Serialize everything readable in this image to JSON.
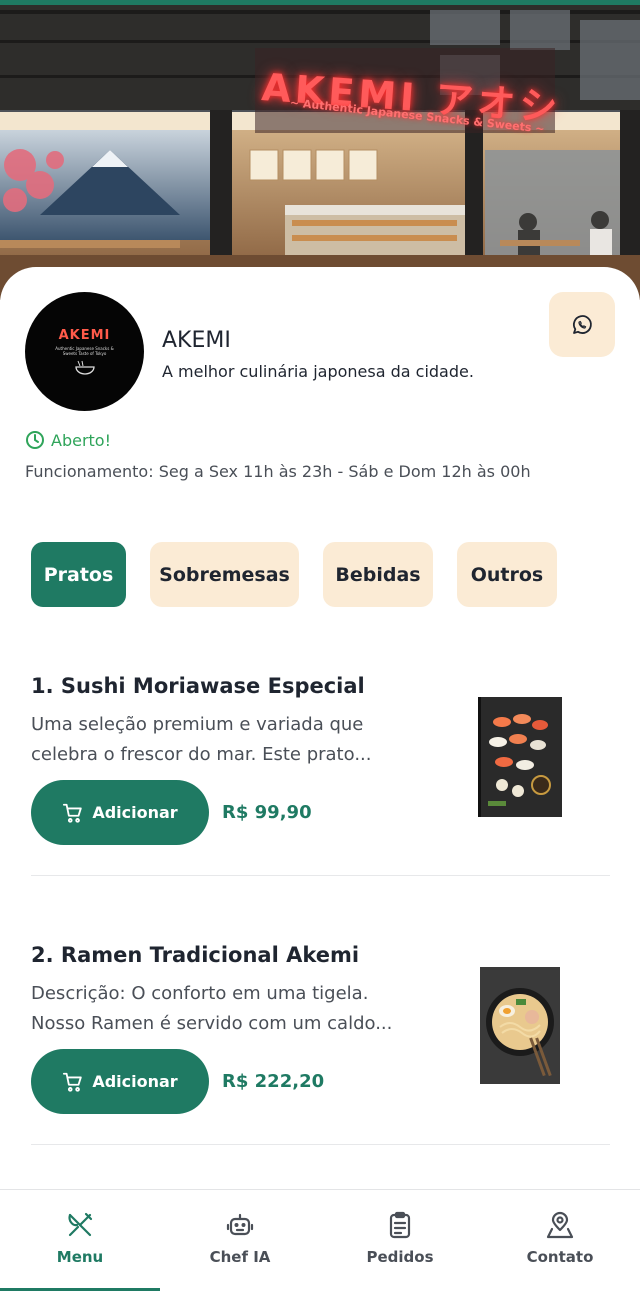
{
  "store": {
    "sign_title": "AKEMI アオシ",
    "sign_subtitle": "~ Authentic Japanese Snacks & Sweets ~",
    "logo_title": "AKEMI",
    "logo_subtitle": "Authentic Japanese Snacks & Sweets Taste of Tokyo",
    "name": "AKEMI",
    "description": "A melhor culinária japonesa da cidade.",
    "status": "Aberto!",
    "hours": "Funcionamento: Seg a Sex 11h às 23h - Sáb e Dom 12h às 00h"
  },
  "tabs": [
    {
      "label": "Pratos",
      "active": true
    },
    {
      "label": "Sobremesas",
      "active": false
    },
    {
      "label": "Bebidas",
      "active": false
    },
    {
      "label": "Outros",
      "active": false
    }
  ],
  "products": [
    {
      "name": "1. Sushi Moriawase Especial",
      "description": "Uma seleção premium e variada que celebra o frescor do mar. Este prato...",
      "add_label": "Adicionar",
      "price": "R$ 99,90"
    },
    {
      "name": "2. Ramen Tradicional Akemi",
      "description": "Descrição: O conforto em uma tigela. Nosso Ramen é servido com um caldo...",
      "add_label": "Adicionar",
      "price": "R$ 222,20"
    }
  ],
  "nav": [
    {
      "label": "Menu",
      "icon": "utensils-icon",
      "active": true
    },
    {
      "label": "Chef IA",
      "icon": "robot-icon",
      "active": false
    },
    {
      "label": "Pedidos",
      "icon": "clipboard-icon",
      "active": false
    },
    {
      "label": "Contato",
      "icon": "map-pin-icon",
      "active": false
    }
  ],
  "colors": {
    "primary": "#1f7a63",
    "tab_inactive": "#fbebd5",
    "open_status": "#2fa45a",
    "neon": "#ff5a5a"
  }
}
